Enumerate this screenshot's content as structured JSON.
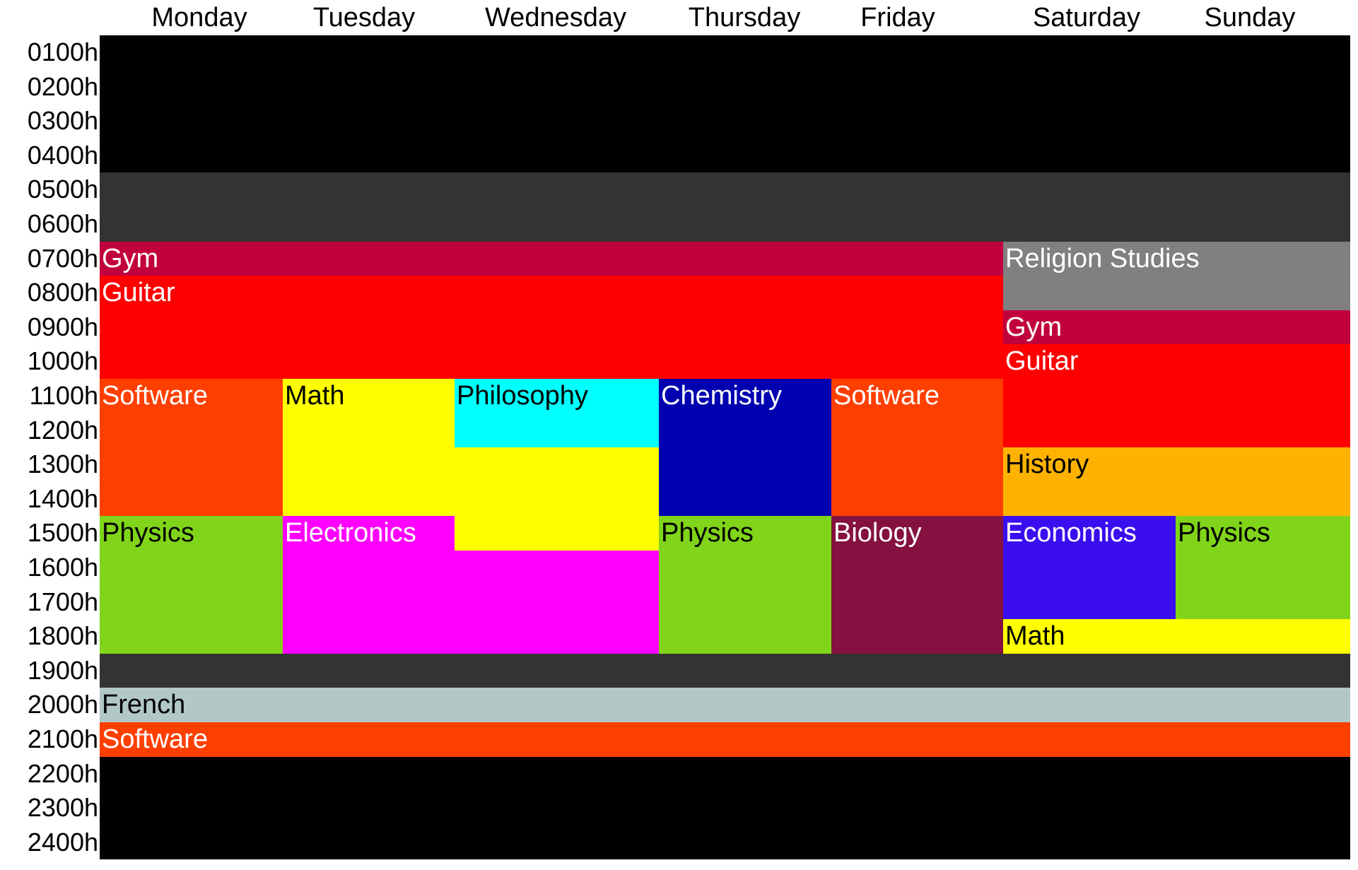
{
  "days": [
    "Monday",
    "Tuesday",
    "Wednesday",
    "Thursday",
    "Friday",
    "Saturday",
    "Sunday"
  ],
  "hours": [
    "0100h",
    "0200h",
    "0300h",
    "0400h",
    "0500h",
    "0600h",
    "0700h",
    "0800h",
    "0900h",
    "1000h",
    "1100h",
    "1200h",
    "1300h",
    "1400h",
    "1500h",
    "1600h",
    "1700h",
    "1800h",
    "1900h",
    "2000h",
    "2100h",
    "2200h",
    "2300h",
    "2400h"
  ],
  "colors": {
    "night": "#000000",
    "early": "#333333",
    "gym": "#c1003e",
    "guitar": "#ff0000",
    "religion": "#808080",
    "software": "#ff3f00",
    "math": "#ffff00",
    "philosophy": "#00ffff",
    "chemistry": "#0000b0",
    "physics": "#80d419",
    "electronics": "#ff00ff",
    "biology": "#84113f",
    "history": "#ffb300",
    "economics": "#3b0ef0",
    "french": "#b2c8c6"
  },
  "blocks": [
    {
      "label": "",
      "days": [
        1,
        7
      ],
      "start": 1,
      "end": 5,
      "color": "night",
      "text": "#ffffff",
      "name": "night-block-early"
    },
    {
      "label": "",
      "days": [
        1,
        7
      ],
      "start": 5,
      "end": 7,
      "color": "early",
      "text": "#ffffff",
      "name": "dawn-block"
    },
    {
      "label": "Gym",
      "days": [
        1,
        5
      ],
      "start": 7,
      "end": 8,
      "color": "gym",
      "text": "#ffffff",
      "name": "weekday-gym-block"
    },
    {
      "label": "Guitar",
      "days": [
        1,
        5
      ],
      "start": 8,
      "end": 11,
      "color": "guitar",
      "text": "#ffffff",
      "name": "weekday-guitar-block"
    },
    {
      "label": "Religion Studies",
      "days": [
        6,
        7
      ],
      "start": 7,
      "end": 9,
      "color": "religion",
      "text": "#ffffff",
      "name": "weekend-religion-block"
    },
    {
      "label": "Gym",
      "days": [
        6,
        7
      ],
      "start": 9,
      "end": 10,
      "color": "gym",
      "text": "#ffffff",
      "name": "weekend-gym-block"
    },
    {
      "label": "Guitar",
      "days": [
        6,
        7
      ],
      "start": 10,
      "end": 13,
      "color": "guitar",
      "text": "#ffffff",
      "name": "weekend-guitar-block"
    },
    {
      "label": "Software",
      "days": [
        1,
        1
      ],
      "start": 11,
      "end": 15,
      "color": "software",
      "text": "#ffffff",
      "name": "monday-software-block"
    },
    {
      "label": "Math",
      "days": [
        2,
        3
      ],
      "start": 11,
      "end": 16,
      "color": "math",
      "text": "#000000",
      "name": "tue-wed-math-block"
    },
    {
      "label": "Philosophy",
      "days": [
        3,
        3
      ],
      "start": 11,
      "end": 13,
      "color": "philosophy",
      "text": "#000000",
      "name": "wednesday-philosophy-block"
    },
    {
      "label": "Chemistry",
      "days": [
        4,
        4
      ],
      "start": 11,
      "end": 15,
      "color": "chemistry",
      "text": "#ffffff",
      "name": "thursday-chemistry-block"
    },
    {
      "label": "Software",
      "days": [
        5,
        5
      ],
      "start": 11,
      "end": 15,
      "color": "software",
      "text": "#ffffff",
      "name": "friday-software-block"
    },
    {
      "label": "History",
      "days": [
        6,
        7
      ],
      "start": 13,
      "end": 15,
      "color": "history",
      "text": "#000000",
      "name": "weekend-history-block"
    },
    {
      "label": "Physics",
      "days": [
        1,
        1
      ],
      "start": 15,
      "end": 19,
      "color": "physics",
      "text": "#000000",
      "name": "monday-physics-block"
    },
    {
      "label": "Electronics",
      "days": [
        2,
        3
      ],
      "start": 15,
      "end": 19,
      "color": "electronics",
      "text": "#ffffff",
      "name": "tue-wed-electronics-block"
    },
    {
      "label": "",
      "days": [
        3,
        3
      ],
      "start": 15,
      "end": 16,
      "color": "math",
      "text": "#000000",
      "name": "wednesday-math-tail"
    },
    {
      "label": "Physics",
      "days": [
        4,
        4
      ],
      "start": 15,
      "end": 19,
      "color": "physics",
      "text": "#000000",
      "name": "thursday-physics-block"
    },
    {
      "label": "Biology",
      "days": [
        5,
        5
      ],
      "start": 15,
      "end": 19,
      "color": "biology",
      "text": "#ffffff",
      "name": "friday-biology-block"
    },
    {
      "label": "Economics",
      "days": [
        6,
        6
      ],
      "start": 15,
      "end": 18,
      "color": "economics",
      "text": "#ffffff",
      "name": "saturday-economics-block"
    },
    {
      "label": "Physics",
      "days": [
        7,
        7
      ],
      "start": 15,
      "end": 18,
      "color": "physics",
      "text": "#000000",
      "name": "sunday-physics-block"
    },
    {
      "label": "Math",
      "days": [
        6,
        7
      ],
      "start": 18,
      "end": 19,
      "color": "math",
      "text": "#000000",
      "name": "weekend-math-block"
    },
    {
      "label": "",
      "days": [
        1,
        7
      ],
      "start": 19,
      "end": 20,
      "color": "early",
      "text": "#ffffff",
      "name": "evening-gap-block"
    },
    {
      "label": "French",
      "days": [
        1,
        7
      ],
      "start": 20,
      "end": 21,
      "color": "french",
      "text": "#000000",
      "name": "french-block"
    },
    {
      "label": "Software",
      "days": [
        1,
        7
      ],
      "start": 21,
      "end": 22,
      "color": "software",
      "text": "#ffffff",
      "name": "evening-software-block"
    },
    {
      "label": "",
      "days": [
        1,
        7
      ],
      "start": 22,
      "end": 25,
      "color": "night",
      "text": "#ffffff",
      "name": "night-block-late"
    }
  ]
}
